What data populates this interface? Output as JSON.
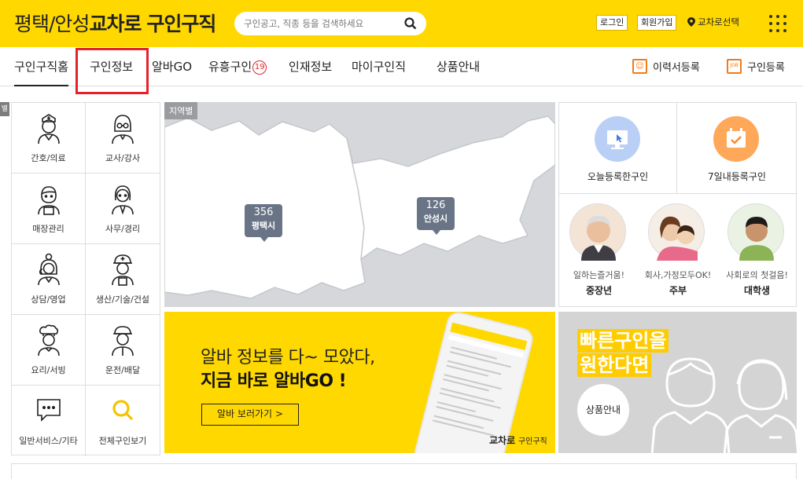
{
  "header": {
    "logo_prefix": "평택/안성",
    "logo_bold": "교차로",
    "logo_suffix": "구인구직",
    "search_placeholder": "구인공고, 직종 등을 검색하세요",
    "login": "로그인",
    "signup": "회원가입",
    "location": "교차로선택",
    "colors": {
      "brand": "#ffd800",
      "highlight_box": "#e3222b"
    }
  },
  "nav": {
    "items": [
      {
        "label": "구인구직홈"
      },
      {
        "label": "구인정보"
      },
      {
        "label": "알바GO"
      },
      {
        "label": "유흥구인"
      },
      {
        "label": "인재정보"
      },
      {
        "label": "마이구인직"
      },
      {
        "label": "상품안내"
      }
    ],
    "badge": "19",
    "resume": "이력서등록",
    "job_post": "구인등록",
    "resume_icon_text": "☺",
    "job_icon_text": "JOB"
  },
  "categories": {
    "tab_label": "별",
    "items": [
      {
        "label": "간호/의료",
        "icon": "nurse-icon"
      },
      {
        "label": "교사/강사",
        "icon": "teacher-icon"
      },
      {
        "label": "매장관리",
        "icon": "store-manager-icon"
      },
      {
        "label": "사무/경리",
        "icon": "office-worker-icon"
      },
      {
        "label": "상담/영업",
        "icon": "consultant-icon"
      },
      {
        "label": "생산/기술/건설",
        "icon": "construction-worker-icon"
      },
      {
        "label": "요리/서빙",
        "icon": "chef-icon"
      },
      {
        "label": "운전/배달",
        "icon": "driver-icon"
      },
      {
        "label": "일반서비스/기타",
        "icon": "chat-bubble-icon"
      },
      {
        "label": "전체구인보기",
        "icon": "search-icon"
      }
    ]
  },
  "map": {
    "tag": "지역별",
    "regions": [
      {
        "name": "평택시",
        "count": "356"
      },
      {
        "name": "안성시",
        "count": "126"
      }
    ]
  },
  "recent": {
    "today": "오늘등록한구인",
    "week": "7일내등록구인",
    "targets": [
      {
        "tagline": "일하는즐거움!",
        "name": "중장년"
      },
      {
        "tagline": "회사,가정모두OK!",
        "name": "주부"
      },
      {
        "tagline": "사회로의 첫걸음!",
        "name": "대학생"
      }
    ]
  },
  "banner": {
    "line1": "알바 정보를 다~ 모았다,",
    "line2": "지금 바로 알바GO !",
    "button": "알바 보러가기 >",
    "brand_bold": "교차로",
    "brand_rest": "구인구직"
  },
  "promo": {
    "line1": "빠른구인을",
    "line2": "원한다면",
    "button": "상품안내"
  }
}
